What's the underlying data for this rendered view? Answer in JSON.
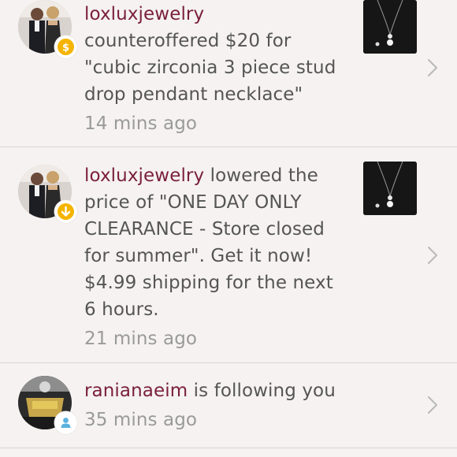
{
  "notifications": [
    {
      "user": "loxluxjewelry",
      "message_lines": [
        "counteroffered $20 for",
        "\"cubic zirconia 3 piece stud",
        "drop pendant necklace\""
      ],
      "time": "14 mins ago",
      "badge_icon": "dollar-icon",
      "badge_color": "#f5b400"
    },
    {
      "user": "loxluxjewelry",
      "first_line_rest": " lowered the",
      "message_lines": [
        "price of \"ONE DAY ONLY",
        "CLEARANCE - Store closed",
        "for summer\". Get it now!",
        "$4.99 shipping for the next",
        "6 hours."
      ],
      "time": "21 mins ago",
      "badge_icon": "arrow-down-icon",
      "badge_color": "#f5b400"
    },
    {
      "user": "ranianaeim",
      "first_line_rest": " is following you",
      "time": "35 mins ago",
      "badge_icon": "person-icon",
      "badge_color": "#5ab2de"
    }
  ],
  "colors": {
    "username": "#7a1f3a",
    "text": "#555555",
    "time": "#9a9a9a",
    "background": "#f5f2f1"
  }
}
